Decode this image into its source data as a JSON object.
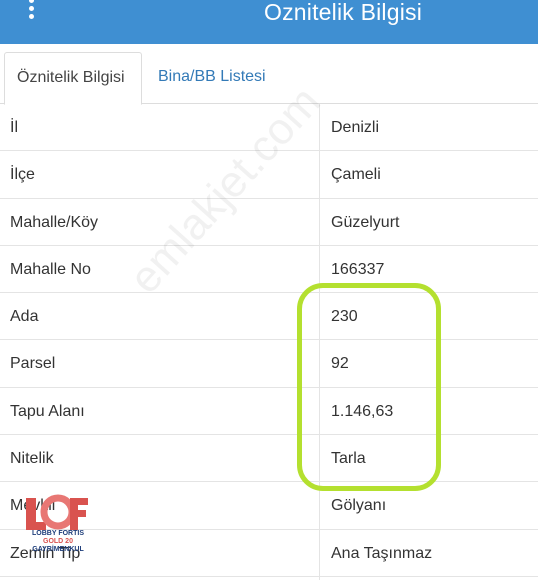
{
  "header": {
    "title": "Oznitelik Bilgisi"
  },
  "tabs": [
    {
      "label": "Öznitelik Bilgisi",
      "active": true
    },
    {
      "label": "Bina/BB Listesi",
      "active": false
    }
  ],
  "attributes": [
    {
      "key": "İl",
      "value": "Denizli"
    },
    {
      "key": "İlçe",
      "value": "Çameli"
    },
    {
      "key": "Mahalle/Köy",
      "value": "Güzelyurt"
    },
    {
      "key": "Mahalle No",
      "value": "166337"
    },
    {
      "key": "Ada",
      "value": "230"
    },
    {
      "key": "Parsel",
      "value": "92"
    },
    {
      "key": "Tapu Alanı",
      "value": "1.146,63"
    },
    {
      "key": "Nitelik",
      "value": "Tarla"
    },
    {
      "key": "Mevkii",
      "value": "Gölyanı"
    },
    {
      "key": "Zemin Tip",
      "value": "Ana Taşınmaz"
    }
  ],
  "watermark": "emlakjet.com",
  "logo": {
    "line1": "LOBBY FORTIS",
    "line2": "GOLD 20",
    "line3": "GAYRİMENKUL"
  },
  "colors": {
    "header_bg": "#3f8fd2",
    "tab_link": "#337ab7",
    "highlight": "#b4e02f"
  }
}
